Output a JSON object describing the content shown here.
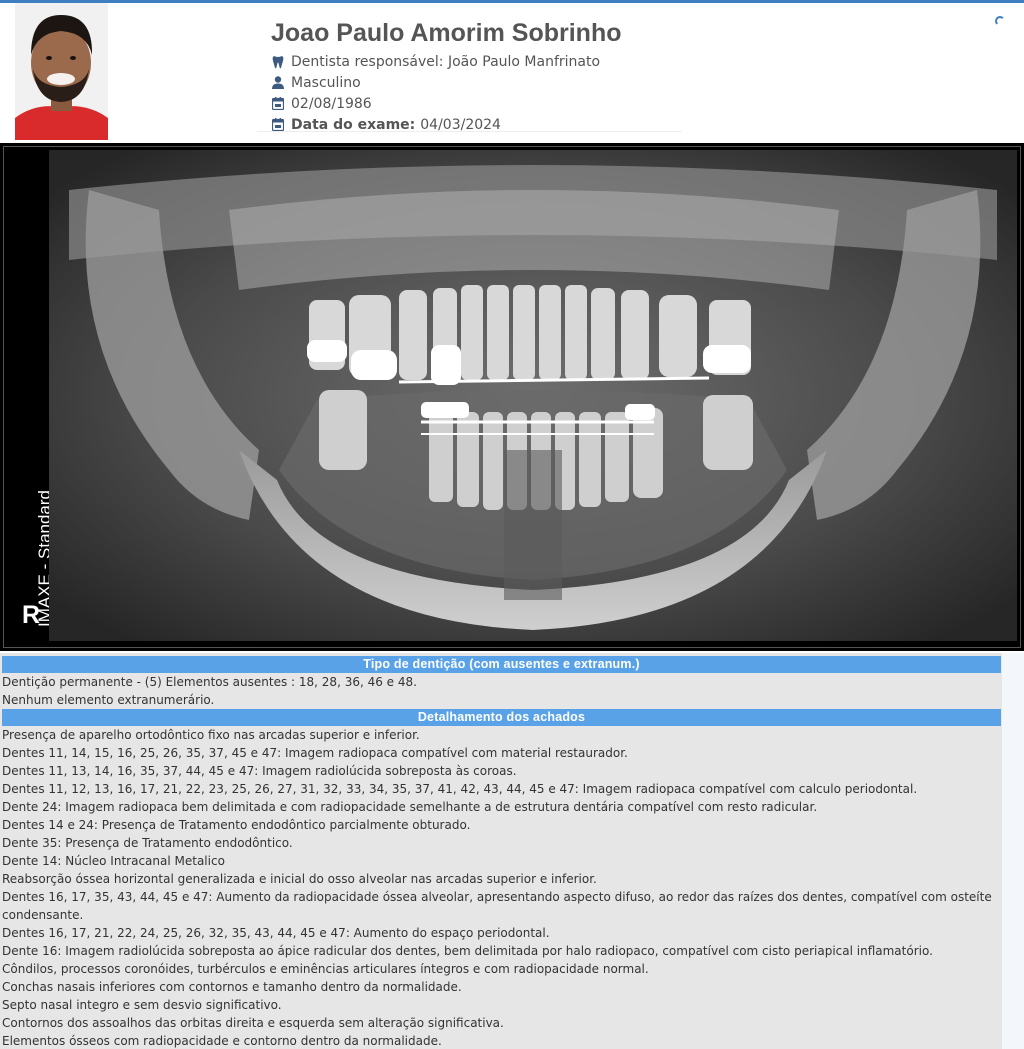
{
  "patient": {
    "name": "Joao Paulo Amorim Sobrinho",
    "dentist_label": "Dentista responsável: João Paulo Manfrinato",
    "gender": "Masculino",
    "birth_date": "02/08/1986",
    "exam_label": "Data do exame:",
    "exam_date": "04/03/2024"
  },
  "icons": {
    "dentist": "tooth-icon",
    "gender": "user-icon",
    "birth": "calendar-icon",
    "exam": "calendar-icon",
    "loading": "spinner-icon"
  },
  "xray": {
    "side_label": "IMAXE - Standard",
    "orientation_mark": "R"
  },
  "colors": {
    "accent": "#3d7fc1",
    "section_header": "#5aa2e8",
    "report_bg": "#e6e6e6"
  },
  "report": {
    "section1_title": "Tipo de dentição (com ausentes e extranum.)",
    "section1_lines": [
      "Dentição permanente - (5) Elementos ausentes : 18, 28, 36, 46 e 48.",
      "Nenhum elemento extranumerário."
    ],
    "section2_title": "Detalhamento dos achados",
    "section2_lines": [
      "Presença de aparelho ortodôntico fixo nas arcadas superior e inferior.",
      "Dentes 11, 14, 15, 16, 25, 26, 35, 37, 45 e 47: Imagem radiopaca compatível com material restaurador.",
      "Dentes 11, 13, 14, 16, 35, 37, 44, 45 e 47: Imagem radiolúcida sobreposta às coroas.",
      "Dentes 11, 12, 13, 16, 17, 21, 22, 23, 25, 26, 27, 31, 32, 33, 34, 35, 37, 41, 42, 43, 44, 45 e 47: Imagem radiopaca compatível com calculo periodontal.",
      "Dente 24: Imagem radiopaca bem delimitada e com radiopacidade semelhante a de estrutura dentária compatível com resto radicular.",
      "Dentes 14 e 24: Presença de Tratamento endodôntico parcialmente obturado.",
      "Dente 35: Presença de Tratamento endodôntico.",
      "Dente 14: Núcleo Intracanal Metalico",
      "Reabsorção óssea horizontal generalizada e inicial do osso alveolar nas arcadas superior e inferior.",
      "Dentes 16, 17, 35, 43, 44, 45 e 47: Aumento da radiopacidade óssea alveolar, apresentando aspecto difuso, ao redor das raízes dos dentes, compatível com osteíte condensante.",
      "Dentes 16, 17, 21, 22, 24, 25, 26, 32, 35, 43, 44, 45 e 47: Aumento do espaço periodontal.",
      "Dente 16: Imagem radiolúcida sobreposta ao ápice radicular dos dentes, bem delimitada por halo radiopaco, compatível com cisto periapical inflamatório.",
      "Côndilos, processos coronóides, turbérculos e eminências articulares íntegros e com radiopacidade normal.",
      "Conchas nasais inferiores com contornos e tamanho dentro da normalidade.",
      "Septo nasal integro e sem desvio significativo.",
      "Contornos dos assoalhos das orbitas direita e esquerda sem alteração significativa.",
      "Elementos ósseos com radiopacidade e contorno dentro da normalidade."
    ]
  }
}
